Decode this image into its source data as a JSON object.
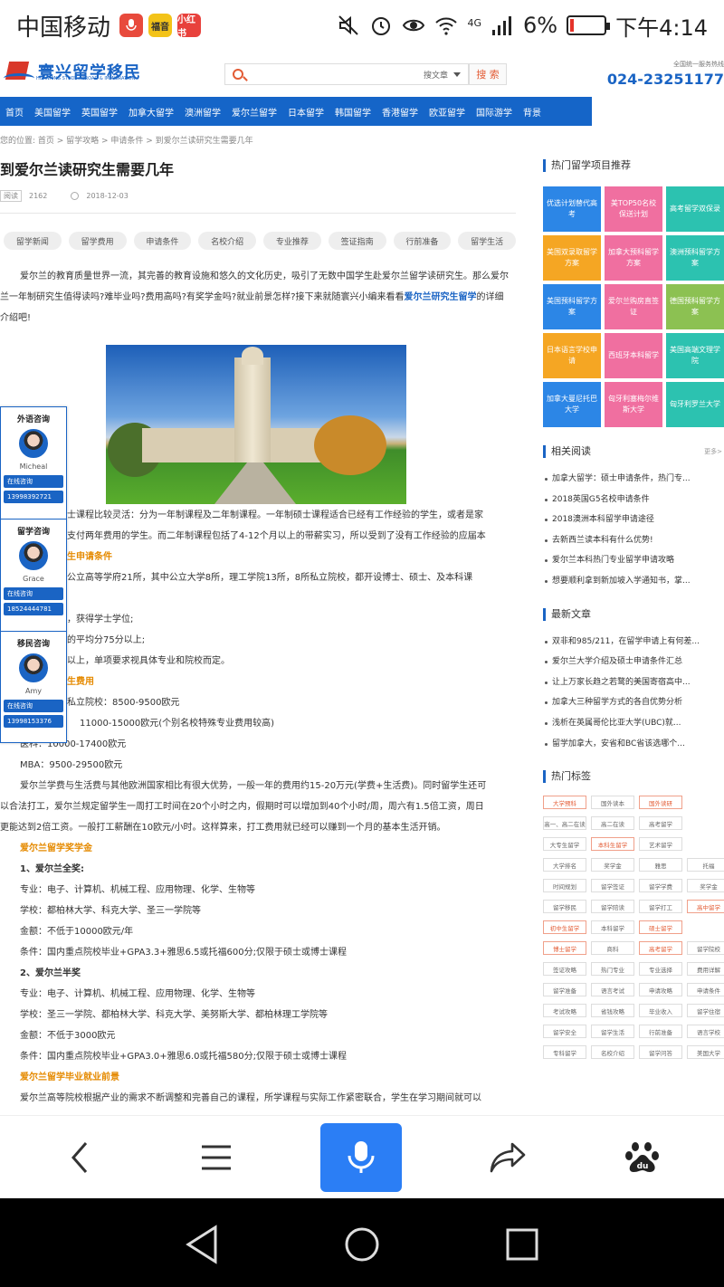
{
  "status_bar": {
    "carrier": "中国移动",
    "app_badges": [
      "福音",
      "小红书"
    ],
    "signal_label": "4G",
    "battery": "6%",
    "time": "下午4:14"
  },
  "site": {
    "logo_text": "寰兴留学移民",
    "logo_sub": "HUANXING STUDY ABROAD & IMMIGRATION",
    "search_scope": "搜文章",
    "search_button": "搜 索",
    "hotline_label": "全国统一服务热线",
    "hotline": "024-23251177",
    "nav": [
      "首页",
      "美国留学",
      "英国留学",
      "加拿大留学",
      "澳洲留学",
      "爱尔兰留学",
      "日本留学",
      "韩国留学",
      "香港留学",
      "欧亚留学",
      "国际游学",
      "背景"
    ],
    "breadcrumb": "您的位置: 首页 > 留学攻略 > 申请条件 > 到爱尔兰读研究生需要几年"
  },
  "article": {
    "title": "到爱尔兰读研究生需要几年",
    "read_tag": "阅读",
    "read_count": "2162",
    "date": "2018-12-03",
    "categories": [
      "留学新闻",
      "留学费用",
      "申请条件",
      "名校介绍",
      "专业推荐",
      "签证指南",
      "行前准备",
      "留学生活"
    ],
    "intro_1": "爱尔兰的教育质量世界一流，其完善的教育设施和悠久的文化历史，吸引了无数中国学生赴爱尔兰留学读研究生。那",
    "intro_2": "么爱尔兰一年制研究生值得读吗?难毕业吗?费用高吗?有奖学金吗?就业前景怎样?接下来就随寰兴小编来看看",
    "intro_link": "爱尔兰研究生留学",
    "intro_3": "的详细介绍吧!",
    "lines": [
      {
        "t": "士课程比较灵活：分为一年制课程及二年制课程。一年制硕士课程适合已经有工作经验的学生，或者是家",
        "k": "n",
        "x": 74
      },
      {
        "t": "支付两年费用的学生。而二年制课程包括了4-12个月以上的带薪实习，所以受到了没有工作经验的应届本",
        "k": "n",
        "x": 74
      },
      {
        "t": "生申请条件",
        "k": "s",
        "x": 74
      },
      {
        "t": "公立高等学府21所，其中公立大学8所，理工学院13所，8所私立院校，都开设博士、硕士、及本科课",
        "k": "n",
        "x": 74
      },
      {
        "t": "",
        "k": "n",
        "x": 74
      },
      {
        "t": "，获得学士学位;",
        "k": "n",
        "x": 74
      },
      {
        "t": "的平均分75分以上;",
        "k": "n",
        "x": 74
      },
      {
        "t": "以上，单项要求视具体专业和院校而定。",
        "k": "n",
        "x": 74
      },
      {
        "t": "生费用",
        "k": "s",
        "x": 74
      },
      {
        "t": "私立院校：8500-9500欧元",
        "k": "n",
        "x": 74
      },
      {
        "t": "11000-15000欧元(个别名校特殊专业费用较高)",
        "k": "n",
        "x": 88
      },
      {
        "t": "医科：10000-17400欧元",
        "k": "n",
        "x": 22
      },
      {
        "t": "MBA：9500-29500欧元",
        "k": "n",
        "x": 22
      },
      {
        "t": "爱尔兰学费与生活费与其他欧洲国家相比有很大优势，一般一年的费用约15-20万元(学费+生活费)。同时留学生还可",
        "k": "n",
        "x": 22
      },
      {
        "t": "以合法打工，爱尔兰规定留学生一周打工时间在20个小时之内，假期时可以增加到40个小时/周，周六有1.5倍工资，周日",
        "k": "n",
        "x": 0
      },
      {
        "t": "更能达到2倍工资。一般打工薪酬在10欧元/小时。这样算来，打工费用就已经可以赚到一个月的基本生活开销。",
        "k": "n",
        "x": 0
      },
      {
        "t": "爱尔兰留学奖学金",
        "k": "s",
        "x": 22
      },
      {
        "t": "1、爱尔兰全奖:",
        "k": "b",
        "x": 22
      },
      {
        "t": "专业：电子、计算机、机械工程、应用物理、化学、生物等",
        "k": "n",
        "x": 22
      },
      {
        "t": "学校：都柏林大学、科克大学、圣三一学院等",
        "k": "n",
        "x": 22
      },
      {
        "t": "金额：不低于10000欧元/年",
        "k": "n",
        "x": 22
      },
      {
        "t": "条件：国内重点院校毕业+GPA3.3+雅思6.5或托福600分;仅限于硕士或博士课程",
        "k": "n",
        "x": 22
      },
      {
        "t": "2、爱尔兰半奖",
        "k": "b",
        "x": 22
      },
      {
        "t": "专业：电子、计算机、机械工程、应用物理、化学、生物等",
        "k": "n",
        "x": 22
      },
      {
        "t": "学校：圣三一学院、都柏林大学、科克大学、美努斯大学、都柏林理工学院等",
        "k": "n",
        "x": 22
      },
      {
        "t": "金额：不低于3000欧元",
        "k": "n",
        "x": 22
      },
      {
        "t": "条件：国内重点院校毕业+GPA3.0+雅思6.0或托福580分;仅限于硕士或博士课程",
        "k": "n",
        "x": 22
      },
      {
        "t": "爱尔兰留学毕业就业前景",
        "k": "s",
        "x": 22
      },
      {
        "t": "爱尔兰高等院校根据产业的需求不断调整和完善自己的课程，所学课程与实际工作紧密联合，学生在学习期间就可以",
        "k": "n",
        "x": 22
      }
    ]
  },
  "consult": [
    {
      "title": "外语咨询",
      "name": "Micheal",
      "btn": "在线咨询",
      "phone": "13998392721"
    },
    {
      "title": "留学咨询",
      "name": "Grace",
      "btn": "在线咨询",
      "phone": "18524444781"
    },
    {
      "title": "移民咨询",
      "name": "Amy",
      "btn": "在线咨询",
      "phone": "13998153376"
    }
  ],
  "sidebar": {
    "hot_title": "热门留学项目推荐",
    "tiles": [
      {
        "label": "优选计划替代高考",
        "color": "t-blue"
      },
      {
        "label": "美TOP50名校保送计划",
        "color": "t-pink"
      },
      {
        "label": "高考留学双保录",
        "color": "t-teal"
      },
      {
        "label": "美国双录取留学方案",
        "color": "t-orange"
      },
      {
        "label": "加拿大预科留学方案",
        "color": "t-pink"
      },
      {
        "label": "澳洲预科留学方案",
        "color": "t-teal"
      },
      {
        "label": "美国预科留学方案",
        "color": "t-blue"
      },
      {
        "label": "爱尔兰购房直签证",
        "color": "t-pink"
      },
      {
        "label": "德国预科留学方案",
        "color": "t-green"
      },
      {
        "label": "日本语言学校申请",
        "color": "t-orange"
      },
      {
        "label": "西班牙本科留学",
        "color": "t-pink"
      },
      {
        "label": "美国高端文理学院",
        "color": "t-teal"
      },
      {
        "label": "加拿大曼尼托巴大学",
        "color": "t-blue"
      },
      {
        "label": "匈牙利塞梅尔维斯大学",
        "color": "t-pink"
      },
      {
        "label": "匈牙利罗兰大学",
        "color": "t-teal"
      }
    ],
    "related_title": "相关阅读",
    "related_more": "更多>",
    "related": [
      "加拿大留学：硕士申请条件，热门专...",
      "2018英国G5名校申请条件",
      "2018澳洲本科留学申请途径",
      "去新西兰读本科有什么优势!",
      "爱尔兰本科热门专业留学申请攻略",
      "想要顺利拿到新加坡入学通知书，掌..."
    ],
    "latest_title": "最新文章",
    "latest": [
      "双非和985/211，在留学申请上有何差...",
      "爱尔兰大学介绍及硕士申请条件汇总",
      "让上万家长趋之若鹜的美国寄宿高中...",
      "加拿大三种留学方式的各自优势分析",
      "浅析在英属哥伦比亚大学(UBC)就...",
      "留学加拿大，安省和BC省该选哪个..."
    ],
    "tags_title": "热门标签",
    "tags": [
      {
        "t": "大学预科",
        "hot": true
      },
      {
        "t": "国外读本",
        "hot": false
      },
      {
        "t": "国外读研",
        "hot": true
      },
      {
        "t": "",
        "hot": false
      },
      {
        "t": "高一、高二在读",
        "hot": false
      },
      {
        "t": "高二在读",
        "hot": false
      },
      {
        "t": "高考留学",
        "hot": false
      },
      {
        "t": "",
        "hot": false
      },
      {
        "t": "大专生留学",
        "hot": false
      },
      {
        "t": "本科生留学",
        "hot": true
      },
      {
        "t": "艺术留学",
        "hot": false
      },
      {
        "t": "",
        "hot": false
      },
      {
        "t": "大学排名",
        "hot": false
      },
      {
        "t": "奖学金",
        "hot": false
      },
      {
        "t": "雅思",
        "hot": false
      },
      {
        "t": "托福",
        "hot": false
      },
      {
        "t": "时间规划",
        "hot": false
      },
      {
        "t": "留学签证",
        "hot": false
      },
      {
        "t": "留学学费",
        "hot": false
      },
      {
        "t": "奖学金",
        "hot": false
      },
      {
        "t": "留学移民",
        "hot": false
      },
      {
        "t": "留学陪读",
        "hot": false
      },
      {
        "t": "留学打工",
        "hot": false
      },
      {
        "t": "高中留学",
        "hot": true
      },
      {
        "t": "初中生留学",
        "hot": true
      },
      {
        "t": "本科留学",
        "hot": false
      },
      {
        "t": "硕士留学",
        "hot": true
      },
      {
        "t": "",
        "hot": false
      },
      {
        "t": "博士留学",
        "hot": true
      },
      {
        "t": "商科",
        "hot": false
      },
      {
        "t": "高考留学",
        "hot": true
      },
      {
        "t": "留学院校",
        "hot": false
      },
      {
        "t": "签证攻略",
        "hot": false
      },
      {
        "t": "热门专业",
        "hot": false
      },
      {
        "t": "专业选择",
        "hot": false
      },
      {
        "t": "费用详解",
        "hot": false
      },
      {
        "t": "留学准备",
        "hot": false
      },
      {
        "t": "语言考试",
        "hot": false
      },
      {
        "t": "申请攻略",
        "hot": false
      },
      {
        "t": "申请条件",
        "hot": false
      },
      {
        "t": "考试攻略",
        "hot": false
      },
      {
        "t": "省钱攻略",
        "hot": false
      },
      {
        "t": "毕业收入",
        "hot": false
      },
      {
        "t": "留学住宿",
        "hot": false
      },
      {
        "t": "留学安全",
        "hot": false
      },
      {
        "t": "留学生活",
        "hot": false
      },
      {
        "t": "行前准备",
        "hot": false
      },
      {
        "t": "语言学校",
        "hot": false
      },
      {
        "t": "专科留学",
        "hot": false
      },
      {
        "t": "名校介绍",
        "hot": false
      },
      {
        "t": "留学问答",
        "hot": false
      },
      {
        "t": "美国大学",
        "hot": false
      }
    ]
  },
  "colors": {
    "brand_blue": "#1565c8",
    "accent_orange": "#e58a00",
    "toolbar_mic": "#2b7ef5"
  },
  "toolbar_icons": [
    "back-icon",
    "menu-icon",
    "microphone-icon",
    "share-icon",
    "baidu-paw-icon"
  ],
  "navbar_icons": [
    "back-triangle-icon",
    "home-circle-icon",
    "recents-square-icon"
  ]
}
